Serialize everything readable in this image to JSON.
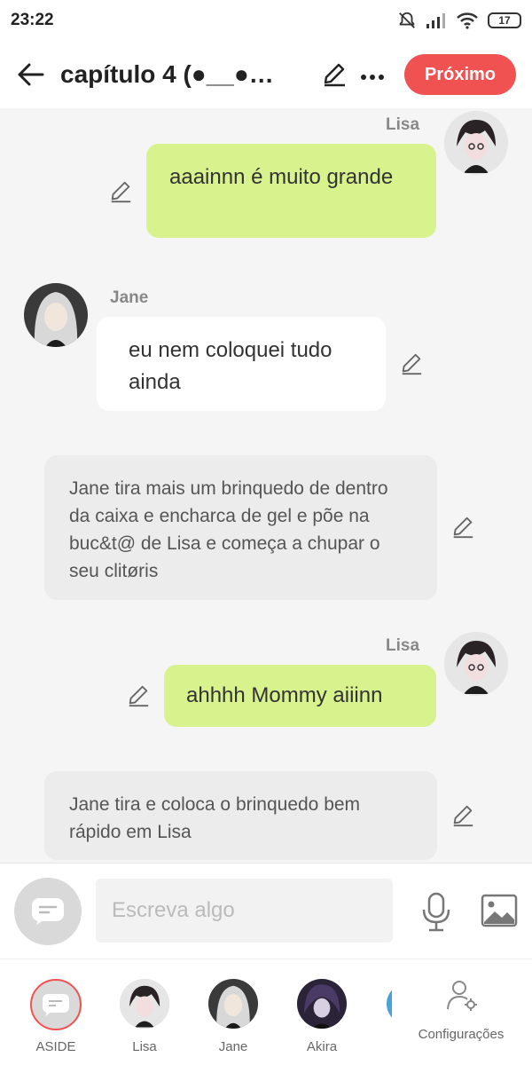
{
  "status_bar": {
    "time": "23:22",
    "battery": "17"
  },
  "header": {
    "title": "capítulo 4  (●__●…",
    "next_label": "Próximo"
  },
  "messages": [
    {
      "type": "character",
      "speaker": "Lisa",
      "side": "right",
      "text": "aaainnn é muito grande"
    },
    {
      "type": "character",
      "speaker": "Jane",
      "side": "left",
      "text": "eu nem coloquei tudo ainda"
    },
    {
      "type": "narration",
      "text": "Jane tira mais um brinquedo de dentro da caixa e encharca de gel e põe na buc&t@ de Lisa e começa a chupar o seu clitøris"
    },
    {
      "type": "character",
      "speaker": "Lisa",
      "side": "right",
      "text": "ahhhh Mommy aiiinn"
    },
    {
      "type": "narration",
      "text": "Jane tira e coloca o brinquedo bem rápido em Lisa"
    }
  ],
  "composer": {
    "placeholder": "Escreva algo"
  },
  "tabs": [
    {
      "label": "ASIDE"
    },
    {
      "label": "Lisa"
    },
    {
      "label": "Jane"
    },
    {
      "label": "Akira"
    },
    {
      "label": "Configurações"
    }
  ],
  "colors": {
    "accent": "#f05252",
    "bubble_green": "#d8f28e",
    "narration_bg": "#ececec",
    "background": "#f5f5f5"
  },
  "icons": [
    "back-arrow-icon",
    "pencil-icon",
    "more-icon",
    "chat-bubble-icon",
    "microphone-icon",
    "image-icon",
    "user-gear-icon",
    "bell-off-icon",
    "signal-icon",
    "wifi-icon",
    "battery-icon"
  ]
}
